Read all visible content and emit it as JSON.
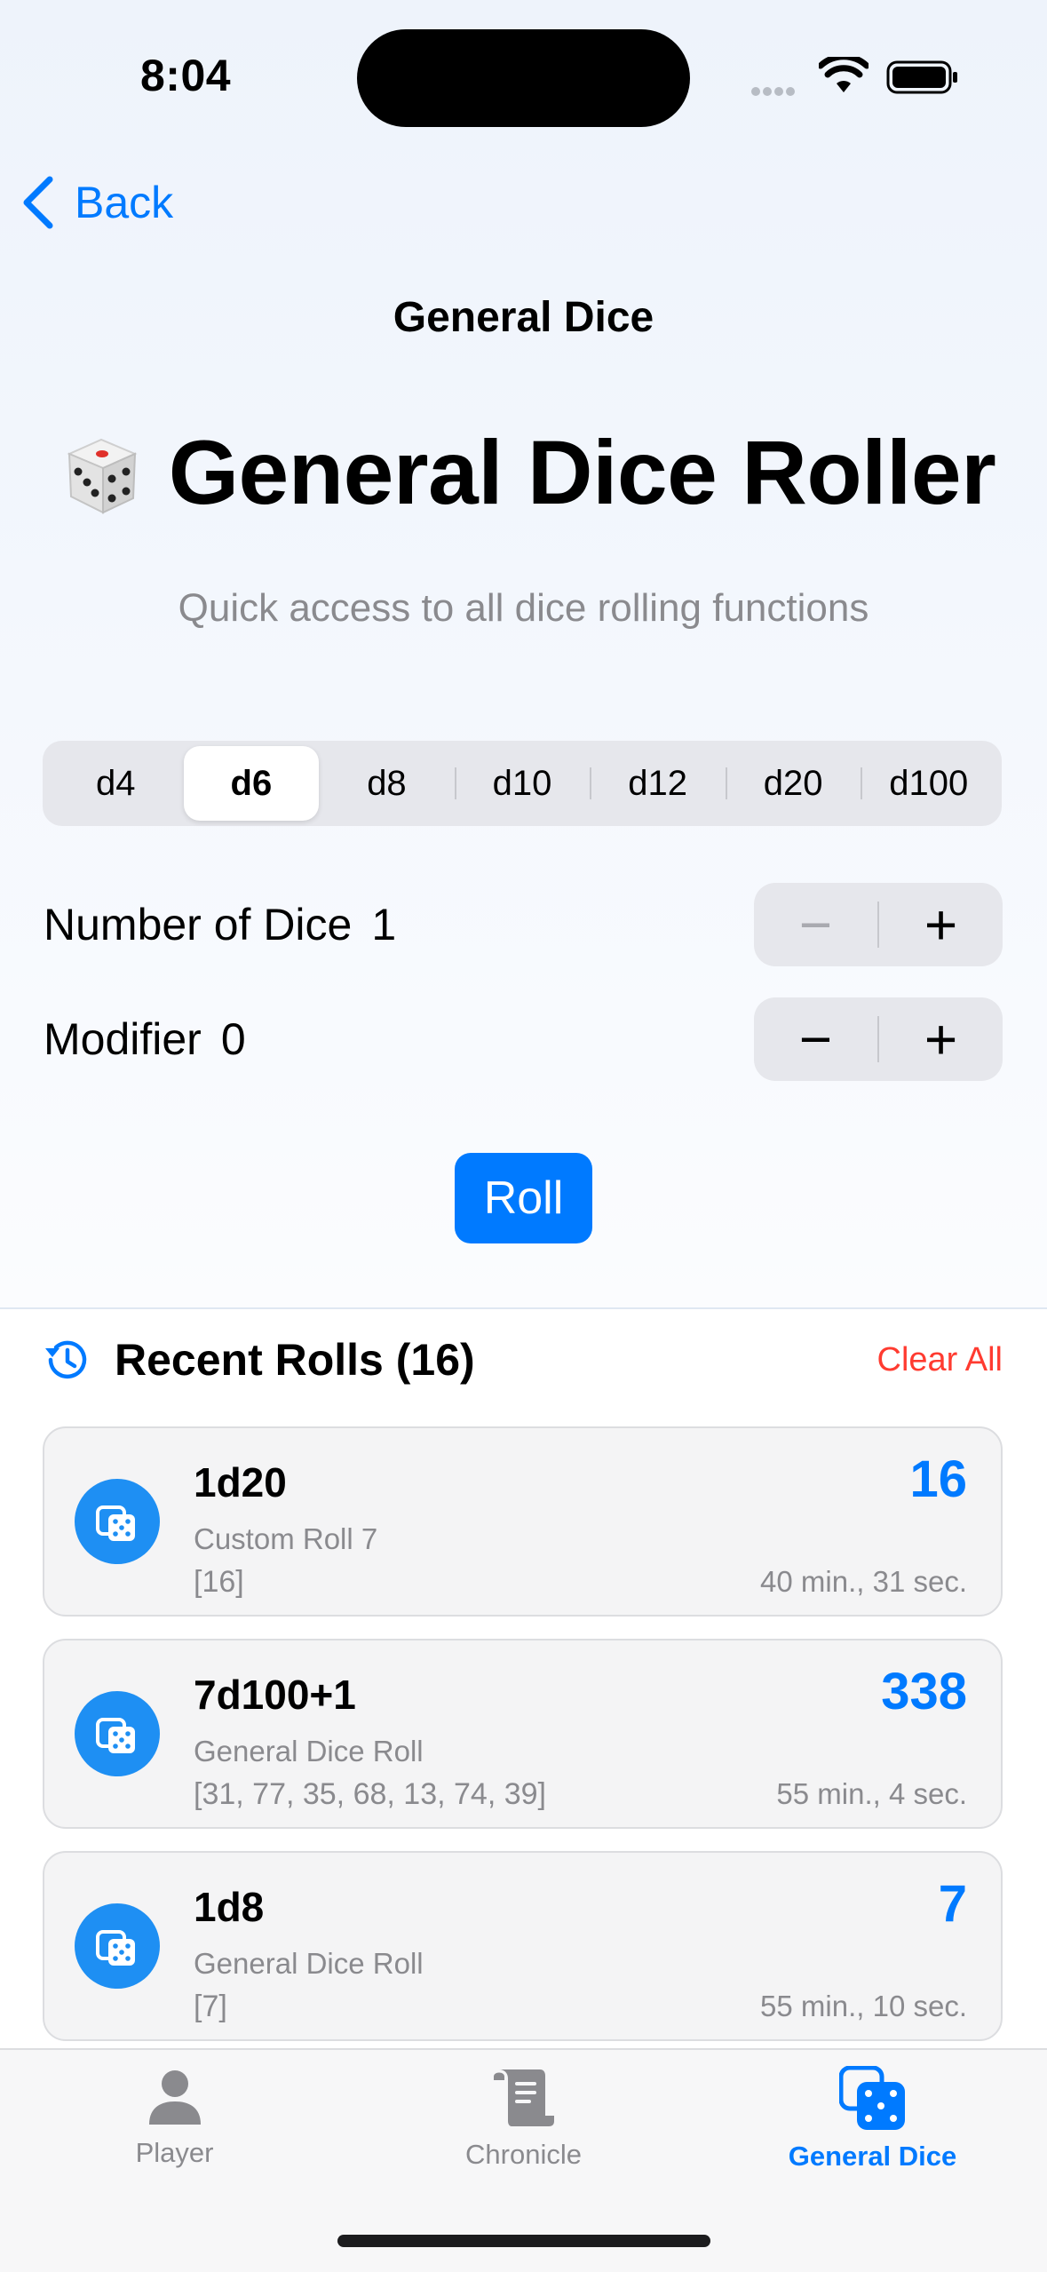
{
  "status": {
    "time": "8:04"
  },
  "nav": {
    "back_label": "Back",
    "title": "General Dice"
  },
  "hero": {
    "emoji": "🎲",
    "title": "General Dice Roller",
    "subtitle": "Quick access to all dice rolling functions"
  },
  "dice_types": [
    "d4",
    "d6",
    "d8",
    "d10",
    "d12",
    "d20",
    "d100"
  ],
  "selected_die": "d6",
  "controls": {
    "number_of_dice": {
      "label": "Number of Dice",
      "value": "1",
      "minus": "−",
      "plus": "+"
    },
    "modifier": {
      "label": "Modifier",
      "value": "0",
      "minus": "−",
      "plus": "+"
    }
  },
  "roll_button": "Roll",
  "recent": {
    "title": "Recent Rolls (16)",
    "clear_label": "Clear All",
    "items": [
      {
        "notation": "1d20",
        "label": "Custom Roll 7",
        "rolls": "[16]",
        "total": "16",
        "time": "40 min., 31 sec."
      },
      {
        "notation": "7d100+1",
        "label": "General Dice Roll",
        "rolls": "[31, 77, 35, 68, 13, 74, 39]",
        "total": "338",
        "time": "55 min., 4 sec."
      },
      {
        "notation": "1d8",
        "label": "General Dice Roll",
        "rolls": "[7]",
        "total": "7",
        "time": "55 min., 10 sec."
      }
    ]
  },
  "tabs": [
    {
      "label": "Player",
      "icon": "person-icon",
      "active": false
    },
    {
      "label": "Chronicle",
      "icon": "scroll-icon",
      "active": false
    },
    {
      "label": "General Dice",
      "icon": "dice-icon",
      "active": true
    }
  ],
  "colors": {
    "accent": "#007aff",
    "destructive": "#ff3b30",
    "secondary_text": "#8a8a8e"
  }
}
